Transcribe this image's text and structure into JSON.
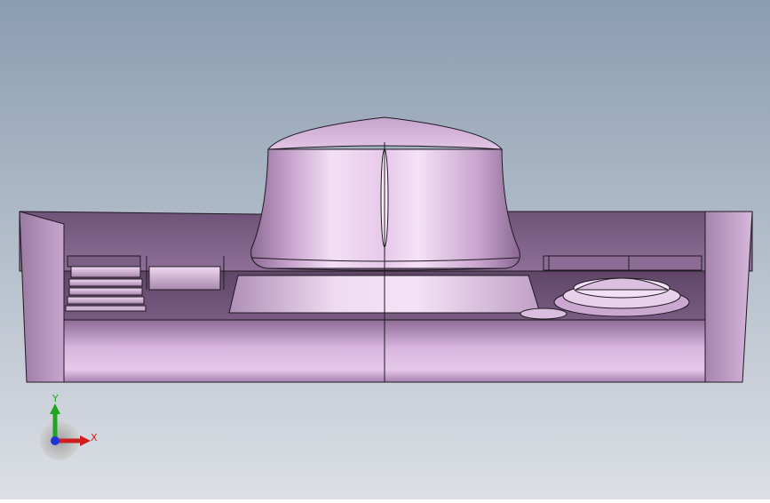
{
  "scene": {
    "background_top": "#8ea0b4",
    "background_bottom": "#dadde4",
    "model_color": "#b090b8",
    "model_highlight": "#efd4f3",
    "edge_color": "#1f1a22"
  },
  "triad": {
    "y_label": "Y",
    "x_label": "X",
    "y_color": "#1fa51f",
    "x_color": "#d01d1d",
    "z_color": "#1f33d6"
  }
}
